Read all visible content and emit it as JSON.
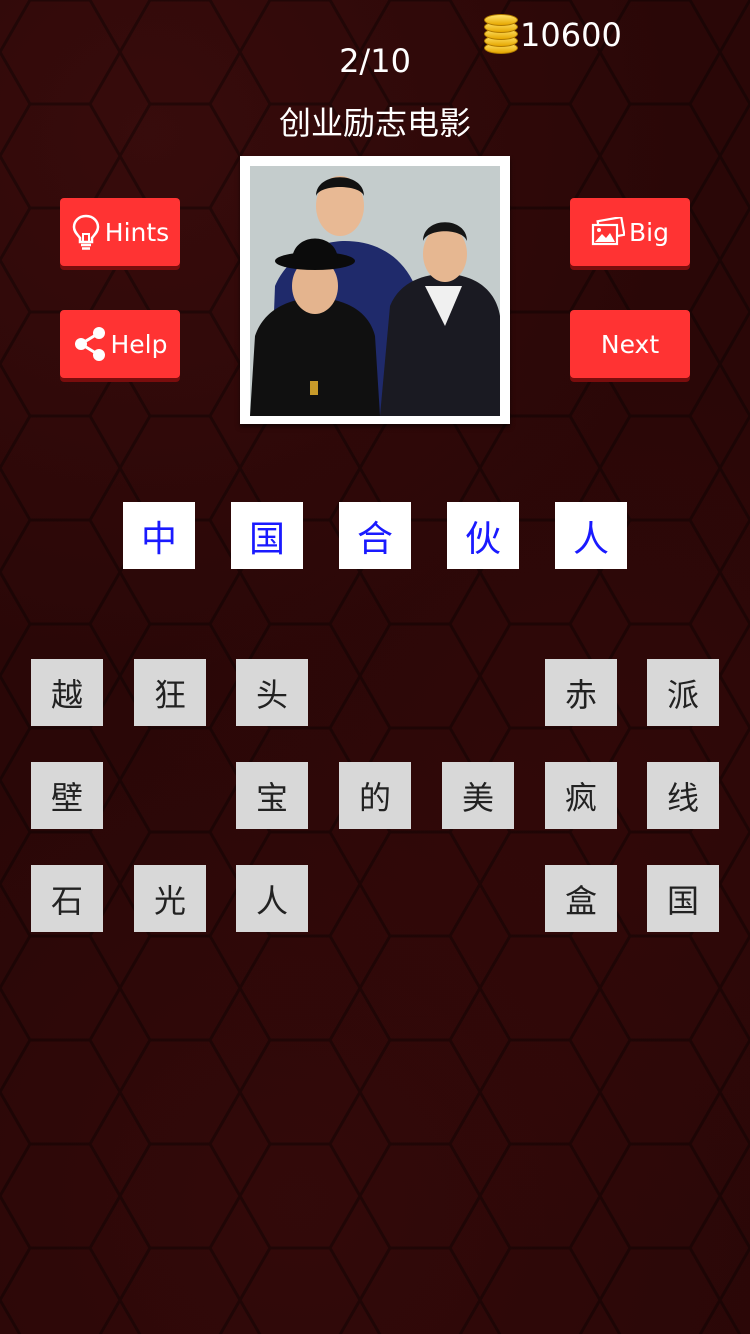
{
  "header": {
    "coins": "10600",
    "level": "2/10",
    "category": "创业励志电影"
  },
  "buttons": {
    "hints": "Hints",
    "big": "Big",
    "help": "Help",
    "next": "Next"
  },
  "icons": {
    "hints": "lightbulb-icon",
    "big": "picture-icon",
    "help": "share-icon",
    "coins": "coin-stack-icon"
  },
  "colors": {
    "button": "#ff3333",
    "answer_text": "#1a1aff",
    "background": "#2a0707"
  },
  "answer": [
    "中",
    "国",
    "合",
    "伙",
    "人"
  ],
  "letters": [
    [
      "越",
      "狂",
      "头",
      "",
      "",
      "赤",
      "派"
    ],
    [
      "壁",
      "",
      "宝",
      "的",
      "美",
      "疯",
      "线"
    ],
    [
      "石",
      "光",
      "人",
      "",
      "",
      "盒",
      "国"
    ]
  ]
}
